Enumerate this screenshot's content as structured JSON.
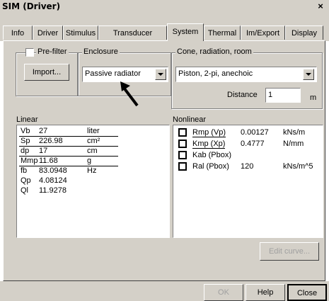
{
  "window": {
    "title": "SIM (Driver)",
    "close_glyph": "×"
  },
  "tabs": [
    {
      "label": "Info"
    },
    {
      "label": "Driver"
    },
    {
      "label": "Stimulus"
    },
    {
      "label": "Transducer"
    },
    {
      "label": "System"
    },
    {
      "label": "Thermal"
    },
    {
      "label": "Im/Export"
    },
    {
      "label": "Display"
    }
  ],
  "system": {
    "prefilter_label": "Pre-filter",
    "import_label": "Import...",
    "enclosure_label": "Enclosure",
    "enclosure_value": "Passive radiator",
    "cone_label": "Cone, radiation, room",
    "cone_value": "Piston, 2-pi, anechoic",
    "distance_label": "Distance",
    "distance_value": "1",
    "distance_unit": "m"
  },
  "linear": {
    "label": "Linear",
    "rows": [
      {
        "name": "Vb",
        "value": "27",
        "unit": "liter"
      },
      {
        "name": "Sp",
        "value": "226.98",
        "unit": "cm²"
      },
      {
        "name": "dp",
        "value": "17",
        "unit": "cm"
      },
      {
        "name": "Mmp",
        "value": "11.68",
        "unit": "g"
      },
      {
        "name": "fb",
        "value": "83.0948",
        "unit": "Hz"
      },
      {
        "name": "Qp",
        "value": "4.08124",
        "unit": ""
      },
      {
        "name": "Ql",
        "value": "11.9278",
        "unit": ""
      }
    ]
  },
  "nonlinear": {
    "label": "Nonlinear",
    "rows": [
      {
        "name": "Rmp (Vp)",
        "value": "0.00127",
        "unit": "kNs/m"
      },
      {
        "name": "Kmp (Xp)",
        "value": "0.4777",
        "unit": "N/mm"
      },
      {
        "name": "Kab (Pbox)",
        "value": "",
        "unit": ""
      },
      {
        "name": "Ral (Pbox)",
        "value": "120",
        "unit": "kNs/m^5"
      }
    ]
  },
  "buttons": {
    "edit_curve": "Edit curve...",
    "ok": "OK",
    "help": "Help",
    "close": "Close"
  },
  "colors": {
    "face": "#d4d0c8",
    "shadow": "#808080",
    "dark": "#404040",
    "highlight": "#ffffff"
  }
}
